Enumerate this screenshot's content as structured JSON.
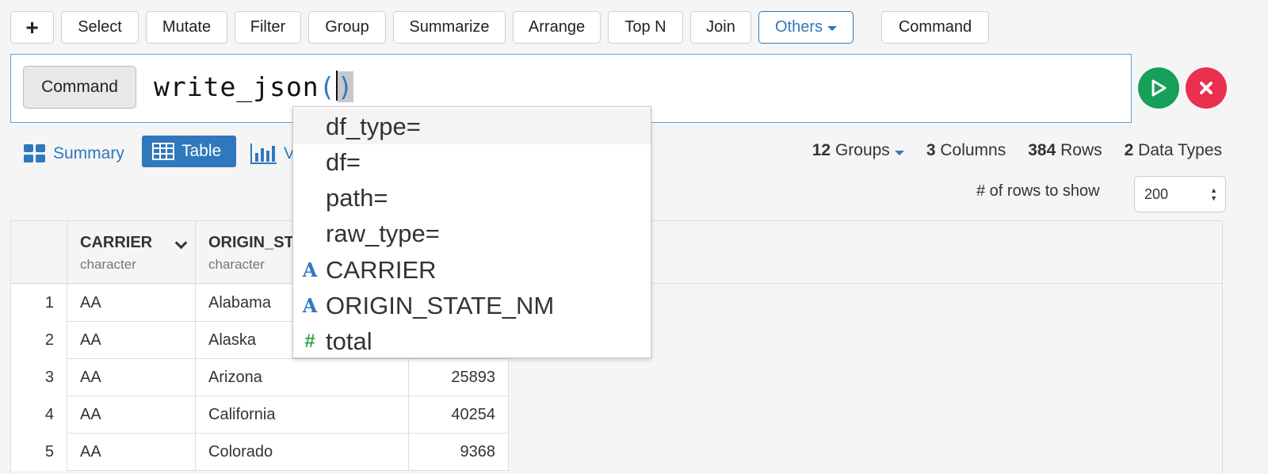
{
  "toolbar": {
    "add_label": "+",
    "buttons": [
      "Select",
      "Mutate",
      "Filter",
      "Group",
      "Summarize",
      "Arrange",
      "Top N",
      "Join"
    ],
    "others_label": "Others",
    "command_label": "Command"
  },
  "command_bar": {
    "label": "Command",
    "fn_text": "write_json",
    "open_paren": "(",
    "close_paren": ")"
  },
  "autocomplete": {
    "items": [
      {
        "label": "df_type=",
        "icon": ""
      },
      {
        "label": "df=",
        "icon": ""
      },
      {
        "label": "path=",
        "icon": ""
      },
      {
        "label": "raw_type=",
        "icon": ""
      },
      {
        "label": "CARRIER",
        "icon": "A"
      },
      {
        "label": "ORIGIN_STATE_NM",
        "icon": "A"
      },
      {
        "label": "total",
        "icon": "#"
      }
    ]
  },
  "view": {
    "summary_label": "Summary",
    "table_label": "Table",
    "viz_label_partial": "V"
  },
  "stats": {
    "groups_count": "12",
    "groups_label": "Groups",
    "columns_count": "3",
    "columns_label": "Columns",
    "rows_count": "384",
    "rows_label": "Rows",
    "types_count": "2",
    "types_label": "Data Types"
  },
  "rows_to_show": {
    "label": "# of rows to show",
    "value": "200"
  },
  "table": {
    "columns": [
      {
        "name": "CARRIER",
        "type": "character"
      },
      {
        "name": "ORIGIN_ST",
        "type": "character"
      }
    ],
    "rows": [
      {
        "idx": "1",
        "carrier": "AA",
        "state": "Alabama",
        "total": ""
      },
      {
        "idx": "2",
        "carrier": "AA",
        "state": "Alaska",
        "total": ""
      },
      {
        "idx": "3",
        "carrier": "AA",
        "state": "Arizona",
        "total": "25893"
      },
      {
        "idx": "4",
        "carrier": "AA",
        "state": "California",
        "total": "40254"
      },
      {
        "idx": "5",
        "carrier": "AA",
        "state": "Colorado",
        "total": "9368"
      }
    ]
  },
  "colors": {
    "accent_blue": "#2f78bd",
    "run_green": "#16a05a",
    "cancel_red": "#ea2f4f",
    "number_icon_green": "#2fa84a"
  }
}
